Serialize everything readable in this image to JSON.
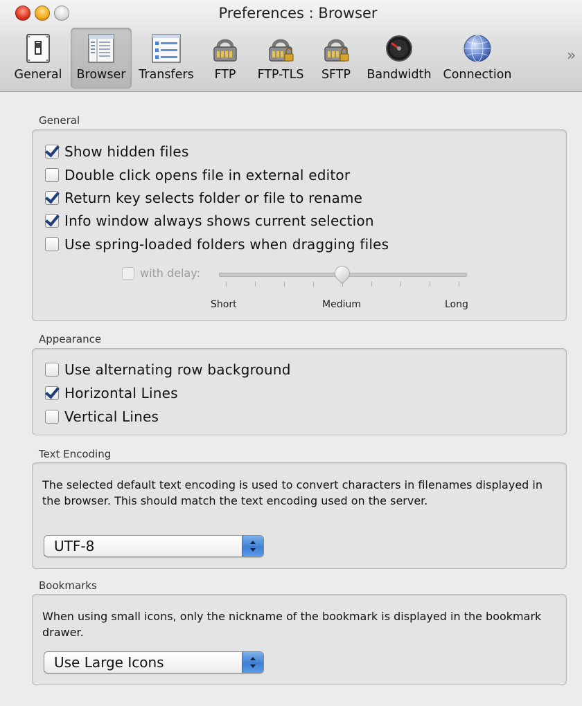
{
  "window": {
    "title": "Preferences : Browser"
  },
  "toolbar": {
    "items": [
      {
        "label": "General",
        "icon": "switch-panel-icon"
      },
      {
        "label": "Browser",
        "icon": "browser-list-icon",
        "selected": true
      },
      {
        "label": "Transfers",
        "icon": "transfers-list-icon"
      },
      {
        "label": "FTP",
        "icon": "ftp-server-icon"
      },
      {
        "label": "FTP-TLS",
        "icon": "ftp-tls-server-icon"
      },
      {
        "label": "SFTP",
        "icon": "sftp-server-icon"
      },
      {
        "label": "Bandwidth",
        "icon": "bandwidth-gauge-icon"
      },
      {
        "label": "Connection",
        "icon": "network-globe-icon"
      }
    ],
    "overflow_symbol": "»"
  },
  "general": {
    "title": "General",
    "options": [
      {
        "label": "Show hidden files",
        "checked": true
      },
      {
        "label": "Double click opens file in external editor",
        "checked": false
      },
      {
        "label": "Return key selects folder or file to rename",
        "checked": true
      },
      {
        "label": "Info window always shows current selection",
        "checked": true
      },
      {
        "label": "Use spring-loaded folders when dragging files",
        "checked": false
      }
    ],
    "delay": {
      "label": "with delay:",
      "checked": false,
      "enabled": false,
      "min_label": "Short",
      "mid_label": "Medium",
      "max_label": "Long",
      "value_fraction": 0.5
    }
  },
  "appearance": {
    "title": "Appearance",
    "options": [
      {
        "label": "Use alternating row background",
        "checked": false
      },
      {
        "label": "Horizontal Lines",
        "checked": true
      },
      {
        "label": "Vertical Lines",
        "checked": false
      }
    ]
  },
  "encoding": {
    "title": "Text Encoding",
    "description": "The selected default text encoding is used to convert characters in filenames displayed in the browser. This should match the text encoding used on the server.",
    "selected": "UTF-8"
  },
  "bookmarks": {
    "title": "Bookmarks",
    "description": "When using small icons, only the nickname of the bookmark is displayed in the bookmark drawer.",
    "selected": "Use Large Icons"
  },
  "colors": {
    "window_bg": "#ececec",
    "checkmark": "#1e3f7a",
    "popup_accent": "#3c7fd6"
  }
}
